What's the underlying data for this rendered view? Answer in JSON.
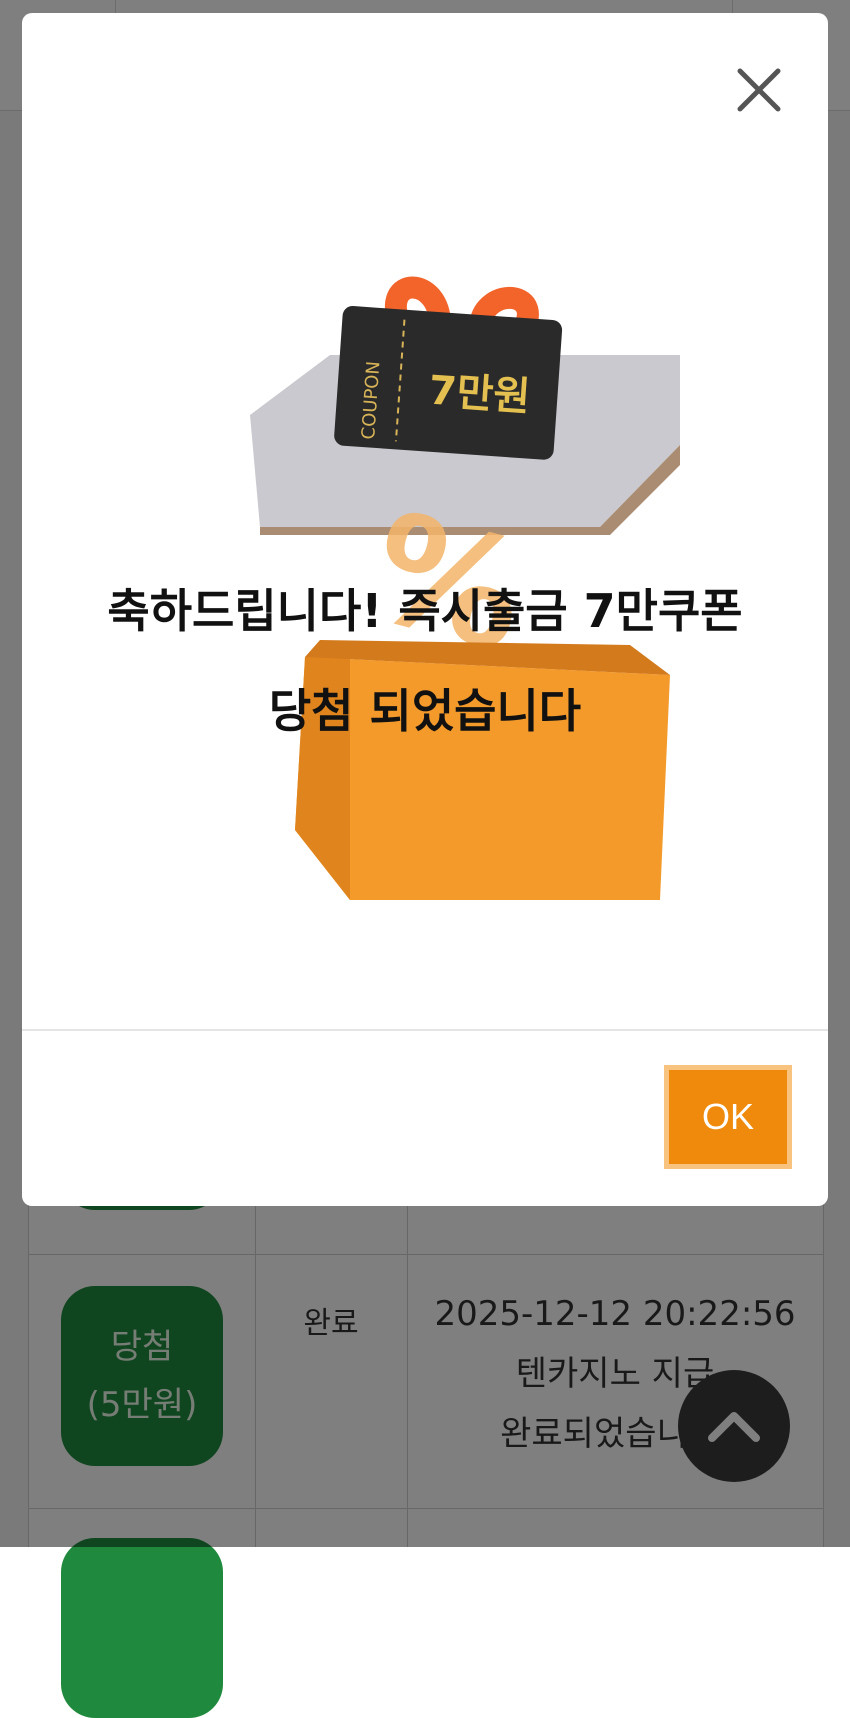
{
  "modal": {
    "message_line1": "축하드립니다! 즉시출금 7만쿠폰",
    "message_line2": "당첨 되었습니다",
    "ok_label": "OK",
    "coupon_label": "COUPON",
    "coupon_amount": "7만원"
  },
  "table": {
    "rows": [
      {
        "badge_line1": "당첨",
        "badge_line2": "(5만원)",
        "status": "완료",
        "detail_line1": "2025-12-12 20:22:56",
        "detail_line2": "텐카지노 지급",
        "detail_line3": "완료되었습니다."
      }
    ]
  },
  "colors": {
    "ok_button": "#f08a0c",
    "badge_green": "#1f8a3e"
  }
}
